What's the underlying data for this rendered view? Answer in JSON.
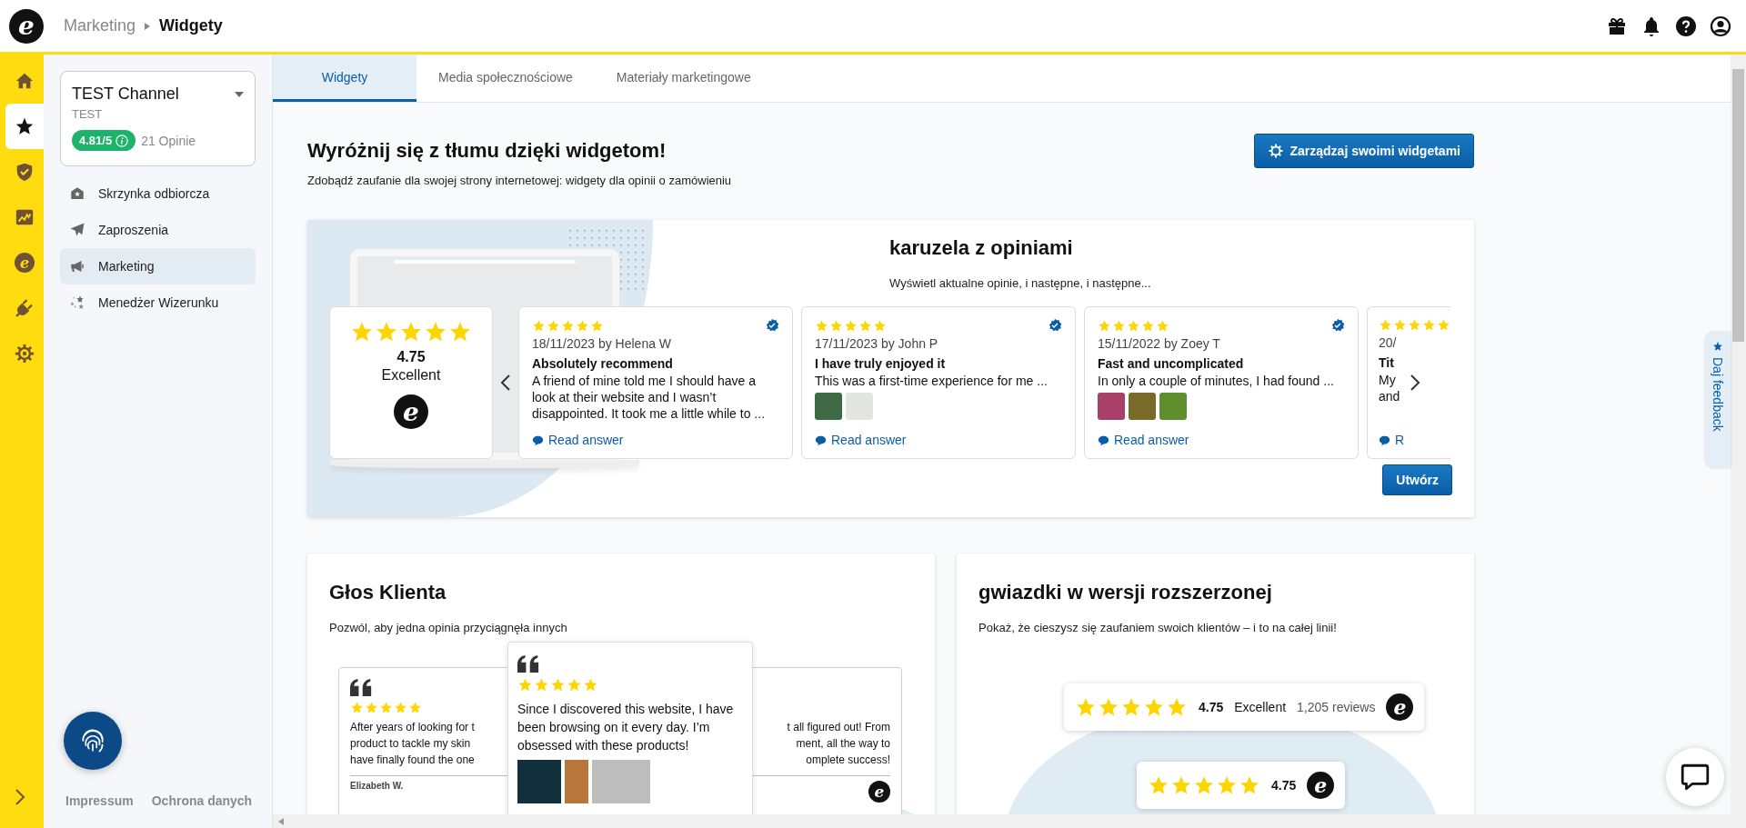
{
  "header": {
    "logo": "e",
    "breadcrumb": [
      {
        "label": "Marketing",
        "selected": false
      },
      {
        "label": "Widgety",
        "selected": true
      }
    ]
  },
  "rail": [
    {
      "kind": "home",
      "selected": false
    },
    {
      "kind": "star",
      "selected": true
    },
    {
      "kind": "shield",
      "selected": false
    },
    {
      "kind": "chart",
      "selected": false
    },
    {
      "kind": "logo",
      "label": "e",
      "selected": false
    },
    {
      "kind": "plug",
      "selected": false
    },
    {
      "kind": "gear",
      "selected": false
    }
  ],
  "channel": {
    "name": "TEST Channel",
    "sub": "TEST",
    "rating": "4.81/5",
    "reviews": "21 Opinie"
  },
  "nav": [
    {
      "kind": "inbox",
      "label": "Skrzynka odbiorcza",
      "selected": false
    },
    {
      "kind": "plane",
      "label": "Zaproszenia",
      "selected": false
    },
    {
      "kind": "megaphone",
      "label": "Marketing",
      "selected": true
    },
    {
      "kind": "stars",
      "label": "Menedżer Wizerunku",
      "selected": false
    }
  ],
  "footer_links": [
    "Impressum",
    "Ochrona danych"
  ],
  "tabs": [
    {
      "label": "Widgety",
      "selected": true
    },
    {
      "label": "Media społecznościowe",
      "selected": false
    },
    {
      "label": "Materiały marketingowe",
      "selected": false
    }
  ],
  "intro": {
    "title": "Wyróżnij się z tłumu dzięki widgetom!",
    "subtitle": "Zdobądź zaufanie dla swojej strony internetowej: widgety dla opinii o zamówieniu",
    "button": "Zarządzaj swoimi widgetami"
  },
  "carousel_widget": {
    "title": "karuzela z opiniami",
    "subtitle": "Wyświetl aktualne opinie, i następne, i następne...",
    "summary": {
      "stars": 5,
      "score": "4.75",
      "label": "Excellent",
      "logo": "e"
    },
    "reviews": [
      {
        "kind": "full",
        "stars": 5,
        "verified": true,
        "meta": "18/11/2023 by Helena W",
        "title": "Absolutely recommend",
        "body": "A friend of mine told me I should have a look at their website and I wasn’t disappointed. It took me a little while to ...",
        "link": "Read answer"
      },
      {
        "kind": "full",
        "stars": 5,
        "verified": true,
        "meta": "17/11/2023 by John P",
        "title": "I have truly enjoyed it",
        "body": "This was a first-time experience for me ...",
        "photos": [
          {
            "kind": "photo"
          },
          {
            "kind": "photo"
          }
        ],
        "link": "Read answer"
      },
      {
        "kind": "full",
        "stars": 5,
        "verified": true,
        "meta": "15/11/2022 by Zoey T",
        "title": "Fast and uncomplicated",
        "body": "In only a couple of minutes, I had found ...",
        "photos": [
          {
            "kind": "photo"
          },
          {
            "kind": "photo"
          },
          {
            "kind": "photo"
          }
        ],
        "link": "Read answer"
      },
      {
        "kind": "cut",
        "stars": 5,
        "verified": false,
        "meta": "20/",
        "title": "Tit",
        "body": "My and",
        "link": "R"
      }
    ],
    "button": "Utwórz"
  },
  "voice_widget": {
    "title": "Głos Klienta",
    "subtitle": "Pozwól, aby jedna opinia przyciągnęła innych",
    "back_card": {
      "stars": 5,
      "left_lines": [
        "After years of looking for t",
        "product to tackle my skin",
        "have finally found the one"
      ],
      "right_lines": [
        "t all figured out! From",
        "ment, all the way to",
        "omplete success!"
      ],
      "author": "Elizabeth W.",
      "logo": "e"
    },
    "front_card": {
      "stars": 5,
      "text": "Since I discovered this website, I have been browsing on it every day. I’m obsessed with these products!",
      "photos": [
        {
          "kind": "photo"
        },
        {
          "kind": "photo"
        },
        {
          "kind": "photo"
        }
      ]
    }
  },
  "stars_widget": {
    "title": "gwiazdki w wersji rozszerzonej",
    "subtitle": "Pokaż, że cieszysz się zaufaniem swoich klientów – i to na całej linii!",
    "badges": [
      {
        "kind": "extended",
        "stars": 5,
        "score": "4.75",
        "label": "Excellent",
        "count": "1,205 reviews",
        "logo": "e"
      },
      {
        "kind": "compact",
        "stars": 5,
        "score": "4.75",
        "logo": "e"
      }
    ]
  },
  "feedback_tab": {
    "label": "Daj feedback"
  }
}
